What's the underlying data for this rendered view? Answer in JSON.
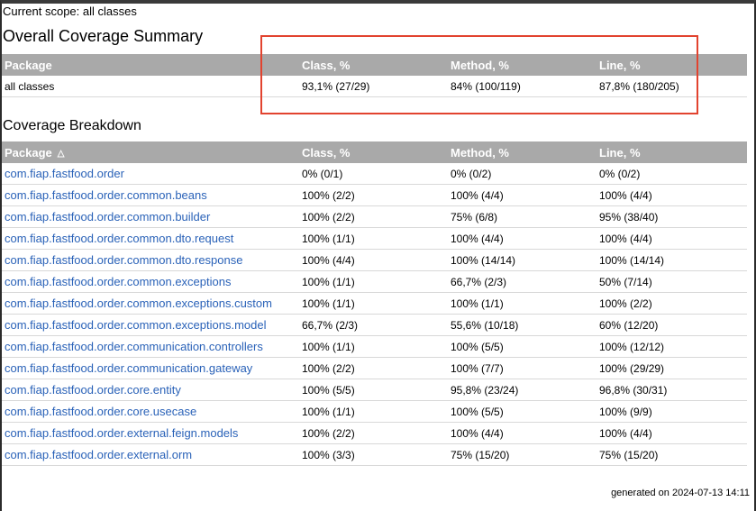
{
  "scope_text": "Current scope: all classes",
  "summary": {
    "title": "Overall Coverage Summary",
    "headers": [
      "Package",
      "Class, %",
      "Method, %",
      "Line, %"
    ],
    "row": [
      "all classes",
      "93,1% (27/29)",
      "84% (100/119)",
      "87,8% (180/205)"
    ]
  },
  "breakdown": {
    "title": "Coverage Breakdown",
    "headers": [
      "Package",
      "Class, %",
      "Method, %",
      "Line, %"
    ],
    "sort_indicator": "△",
    "rows": [
      [
        "com.fiap.fastfood.order",
        "0% (0/1)",
        "0% (0/2)",
        "0% (0/2)"
      ],
      [
        "com.fiap.fastfood.order.common.beans",
        "100% (2/2)",
        "100% (4/4)",
        "100% (4/4)"
      ],
      [
        "com.fiap.fastfood.order.common.builder",
        "100% (2/2)",
        "75% (6/8)",
        "95% (38/40)"
      ],
      [
        "com.fiap.fastfood.order.common.dto.request",
        "100% (1/1)",
        "100% (4/4)",
        "100% (4/4)"
      ],
      [
        "com.fiap.fastfood.order.common.dto.response",
        "100% (4/4)",
        "100% (14/14)",
        "100% (14/14)"
      ],
      [
        "com.fiap.fastfood.order.common.exceptions",
        "100% (1/1)",
        "66,7% (2/3)",
        "50% (7/14)"
      ],
      [
        "com.fiap.fastfood.order.common.exceptions.custom",
        "100% (1/1)",
        "100% (1/1)",
        "100% (2/2)"
      ],
      [
        "com.fiap.fastfood.order.common.exceptions.model",
        "66,7% (2/3)",
        "55,6% (10/18)",
        "60% (12/20)"
      ],
      [
        "com.fiap.fastfood.order.communication.controllers",
        "100% (1/1)",
        "100% (5/5)",
        "100% (12/12)"
      ],
      [
        "com.fiap.fastfood.order.communication.gateway",
        "100% (2/2)",
        "100% (7/7)",
        "100% (29/29)"
      ],
      [
        "com.fiap.fastfood.order.core.entity",
        "100% (5/5)",
        "95,8% (23/24)",
        "96,8% (30/31)"
      ],
      [
        "com.fiap.fastfood.order.core.usecase",
        "100% (1/1)",
        "100% (5/5)",
        "100% (9/9)"
      ],
      [
        "com.fiap.fastfood.order.external.feign.models",
        "100% (2/2)",
        "100% (4/4)",
        "100% (4/4)"
      ],
      [
        "com.fiap.fastfood.order.external.orm",
        "100% (3/3)",
        "75% (15/20)",
        "75% (15/20)"
      ]
    ]
  },
  "footer": "generated on 2024-07-13 14:11",
  "colors": {
    "header_bg": "#a9a9a9",
    "link": "#2a62b8",
    "annotation": "#e2432f"
  }
}
